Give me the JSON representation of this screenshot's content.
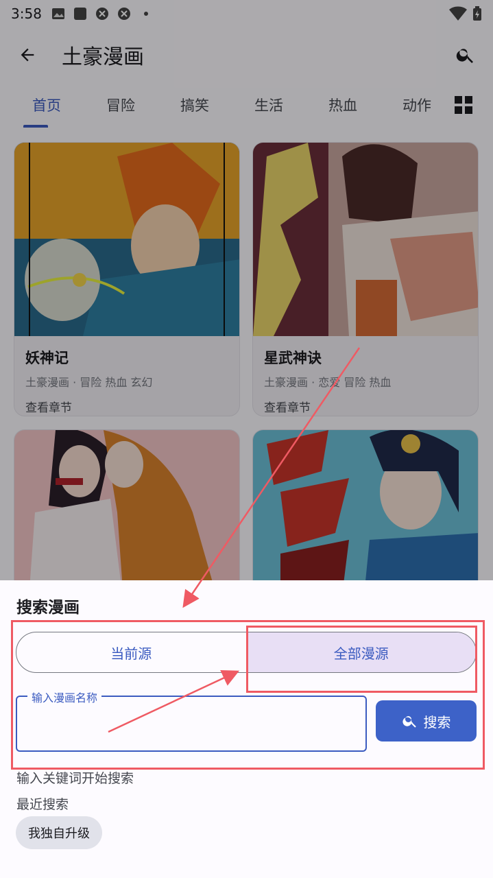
{
  "status_bar": {
    "time": "3:58"
  },
  "app_bar": {
    "title": "土豪漫画"
  },
  "tabs": [
    {
      "label": "首页",
      "active": true
    },
    {
      "label": "冒险",
      "active": false
    },
    {
      "label": "搞笑",
      "active": false
    },
    {
      "label": "生活",
      "active": false
    },
    {
      "label": "热血",
      "active": false
    },
    {
      "label": "动作",
      "active": false
    }
  ],
  "cards": [
    {
      "name": "妖神记",
      "meta": "土豪漫画 · 冒险 热血 玄幻",
      "chapter_link": "查看章节"
    },
    {
      "name": "星武神诀",
      "meta": "土豪漫画 · 恋爱 冒险 热血",
      "chapter_link": "查看章节"
    },
    {
      "name": "",
      "meta": "",
      "chapter_link": ""
    },
    {
      "name": "",
      "meta": "",
      "chapter_link": ""
    }
  ],
  "sheet": {
    "title": "搜索漫画",
    "segment": {
      "left": "当前源",
      "right": "全部漫源",
      "selected": "right"
    },
    "input": {
      "label": "输入漫画名称",
      "value": ""
    },
    "search_button": "搜索",
    "hint": "输入关键词开始搜索",
    "recent_title": "最近搜索",
    "recent_chips": [
      "我独自升级"
    ]
  },
  "colors": {
    "accent": "#3b5bc0",
    "annotation": "#ef5a63",
    "selected_segment": "#e8dff5"
  }
}
